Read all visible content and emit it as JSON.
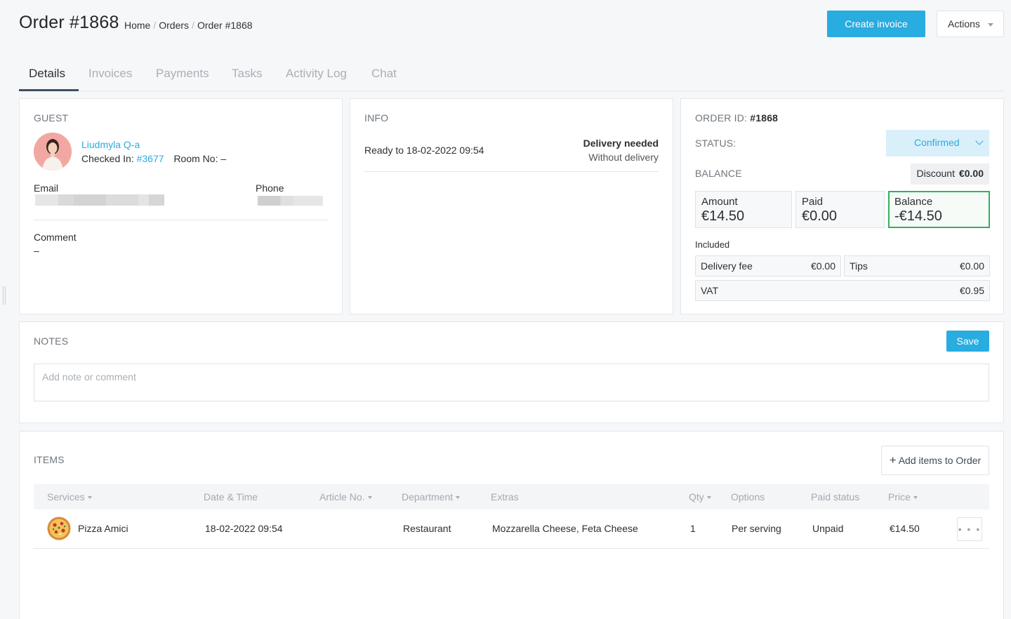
{
  "header": {
    "title": "Order #1868",
    "breadcrumb": [
      "Home",
      "Orders",
      "Order #1868"
    ],
    "breadcrumb_sep": "/",
    "create_invoice_label": "Create invoice",
    "actions_label": "Actions"
  },
  "tabs": [
    {
      "label": "Details",
      "active": true
    },
    {
      "label": "Invoices",
      "active": false
    },
    {
      "label": "Payments",
      "active": false
    },
    {
      "label": "Tasks",
      "active": false
    },
    {
      "label": "Activity Log",
      "active": false
    },
    {
      "label": "Chat",
      "active": false
    }
  ],
  "guest": {
    "section_label": "GUEST",
    "name": "Liudmyla Q-a",
    "checked_in_label": "Checked In:",
    "checked_in_link": "#3677",
    "room_label": "Room No:",
    "room_value": "–",
    "email_label": "Email",
    "phone_label": "Phone",
    "comment_label": "Comment",
    "comment_value": "–"
  },
  "info": {
    "section_label": "INFO",
    "ready_text": "Ready to 18-02-2022 09:54",
    "delivery_title": "Delivery needed",
    "delivery_sub": "Without delivery"
  },
  "order": {
    "id_label": "ORDER ID:",
    "id_value": "#1868",
    "status_label": "STATUS:",
    "status_value": "Confirmed",
    "balance_label": "BALANCE",
    "discount_label": "Discount",
    "discount_value": "€0.00",
    "amount_label": "Amount",
    "amount_value": "€14.50",
    "paid_label": "Paid",
    "paid_value": "€0.00",
    "balance_box_label": "Balance",
    "balance_value": "-€14.50",
    "included_label": "Included",
    "delivery_fee_label": "Delivery fee",
    "delivery_fee_value": "€0.00",
    "tips_label": "Tips",
    "tips_value": "€0.00",
    "vat_label": "VAT",
    "vat_value": "€0.95"
  },
  "notes": {
    "section_label": "NOTES",
    "save_label": "Save",
    "placeholder": "Add note or comment"
  },
  "items": {
    "section_label": "ITEMS",
    "add_label": "Add items to Order",
    "columns": [
      "Services",
      "Date & Time",
      "Article No.",
      "Department",
      "Extras",
      "Qty",
      "Options",
      "Paid status",
      "Price"
    ],
    "rows": [
      {
        "service": "Pizza Amici",
        "datetime": "18-02-2022 09:54",
        "article": "",
        "department": "Restaurant",
        "extras": "Mozzarella Cheese, Feta Cheese",
        "qty": "1",
        "options": "Per serving",
        "paid_status": "Unpaid",
        "price": "€14.50"
      }
    ],
    "more_label": "• • •"
  },
  "icons": {
    "plus": "plus-icon",
    "caret": "caret-down-icon",
    "chevron": "chevron-down-icon",
    "avatar": "avatar",
    "pizza": "pizza-icon"
  },
  "colors": {
    "accent": "#29ace0",
    "status_bg": "#d9f0fa",
    "balance_border": "#2fb35c"
  }
}
